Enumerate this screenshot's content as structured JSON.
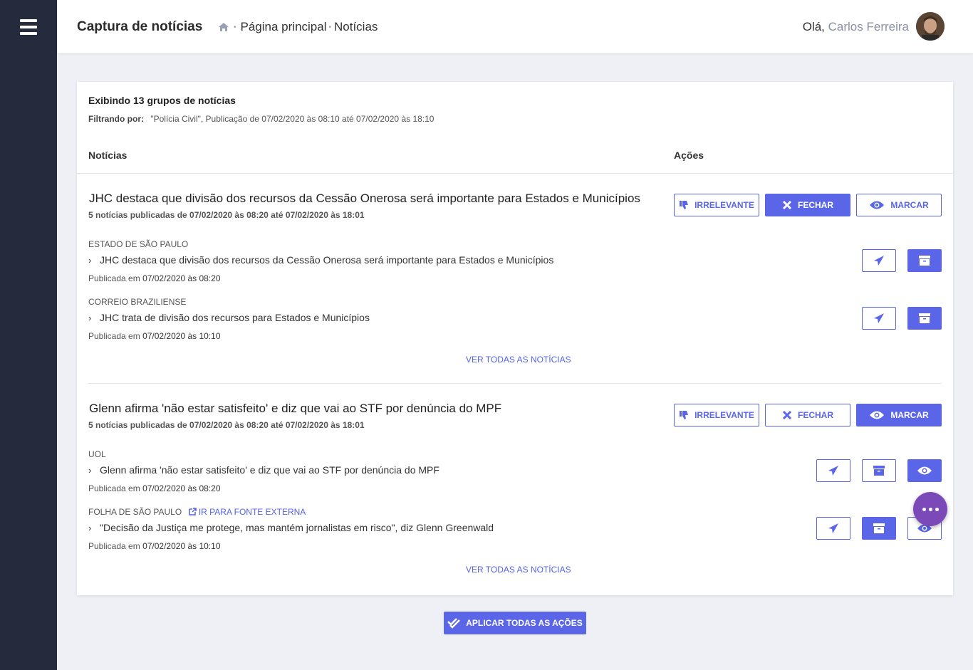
{
  "header": {
    "app_title": "Captura de notícias",
    "breadcrumb": [
      "Página principal",
      "Notícias"
    ],
    "greeting": "Olá,",
    "user_name": "Carlos Ferreira"
  },
  "summary": {
    "title": "Exibindo 13 grupos de notícias",
    "filter_label": "Filtrando por:",
    "filter_value": "\"Polícia Civil\", Publicação de 07/02/2020 às 08:10 até 07/02/2020 às 18:10"
  },
  "columns": {
    "news": "Notícias",
    "actions": "Ações"
  },
  "actions": {
    "irrelevant": "IRRELEVANTE",
    "close": "FECHAR",
    "mark": "MARCAR"
  },
  "groups": [
    {
      "title": "JHC destaca que divisão dos recursos da Cessão Onerosa será importante para Estados e Municípios",
      "subtitle": "5 notícias publicadas de 07/02/2020 às 08:20 até 07/02/2020 às 18:01",
      "articles": [
        {
          "source": "ESTADO DE SÃO PAULO",
          "headline": "JHC destaca que divisão dos recursos da Cessão Onerosa será importante para Estados e Municípios",
          "published_prefix": "Publicada em",
          "published_at": "07/02/2020 às 08:20"
        },
        {
          "source": "CORREIO BRAZILIENSE",
          "headline": "JHC trata de divisão dos recursos para Estados e Municípios",
          "published_prefix": "Publicada em",
          "published_at": "07/02/2020 às 10:10"
        }
      ],
      "see_all": "VER TODAS AS NOTÍCIAS"
    },
    {
      "title": "Glenn afirma 'não estar satisfeito' e diz que vai ao STF por denúncia do MPF",
      "subtitle": "5 notícias publicadas de 07/02/2020 às 08:20 até 07/02/2020 às 18:01",
      "articles": [
        {
          "source": "UOL",
          "headline": "Glenn afirma 'não estar satisfeito' e diz que vai ao STF por denúncia do MPF",
          "published_prefix": "Publicada em",
          "published_at": "07/02/2020 às 08:20"
        },
        {
          "source": "FOLHA DE SÃO PAULO",
          "external_link": "IR PARA FONTE EXTERNA",
          "headline": "\"Decisão da Justiça me protege, mas mantém jornalistas em risco\", diz Glenn Greenwald",
          "published_prefix": "Publicada em",
          "published_at": "07/02/2020 às 10:10"
        }
      ],
      "see_all": "VER TODAS AS NOTÍCIAS"
    }
  ],
  "apply_all": "APLICAR TODAS AS AÇÕES",
  "colors": {
    "accent": "#5a65e8",
    "sidebar": "#252a3d",
    "fab": "#7c4ab8"
  }
}
